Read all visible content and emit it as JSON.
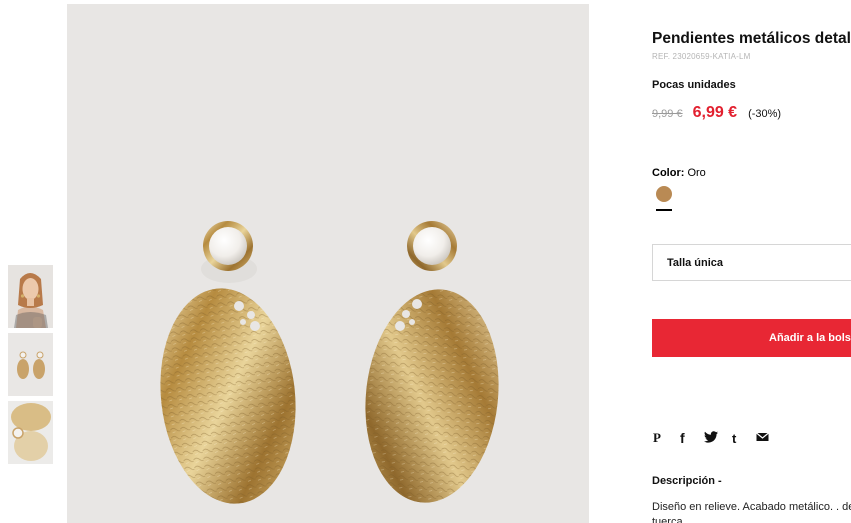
{
  "product": {
    "title": "Pendientes metálicos detall",
    "ref": "REF. 23020659-KATIA-LM",
    "stock_status": "Pocas unidades",
    "old_price": "9,99 €",
    "new_price": "6,99 €",
    "discount": "(-30%)",
    "color_label": "Color:",
    "color_value": "Oro",
    "swatch_color": "#b98a54",
    "size_select": "Talla única",
    "add_button": "Añadir a la bols",
    "description_title": "Descripción -",
    "description_text": "Diseño en relieve. Acabado metálico. . de tuerca"
  },
  "share_icons": [
    "pinterest-icon",
    "facebook-icon",
    "twitter-icon",
    "tumblr-icon",
    "email-icon"
  ],
  "share_glyphs": {
    "pinterest": "P",
    "facebook": "f",
    "tumblr": "t"
  },
  "thumbnails": [
    "model-wearing-earrings",
    "earrings-front",
    "earrings-closeup"
  ],
  "colors": {
    "accent": "#e82734",
    "sale_price": "#e2202f",
    "image_bg": "#e8e6e4",
    "gold": "#c9a36a"
  }
}
